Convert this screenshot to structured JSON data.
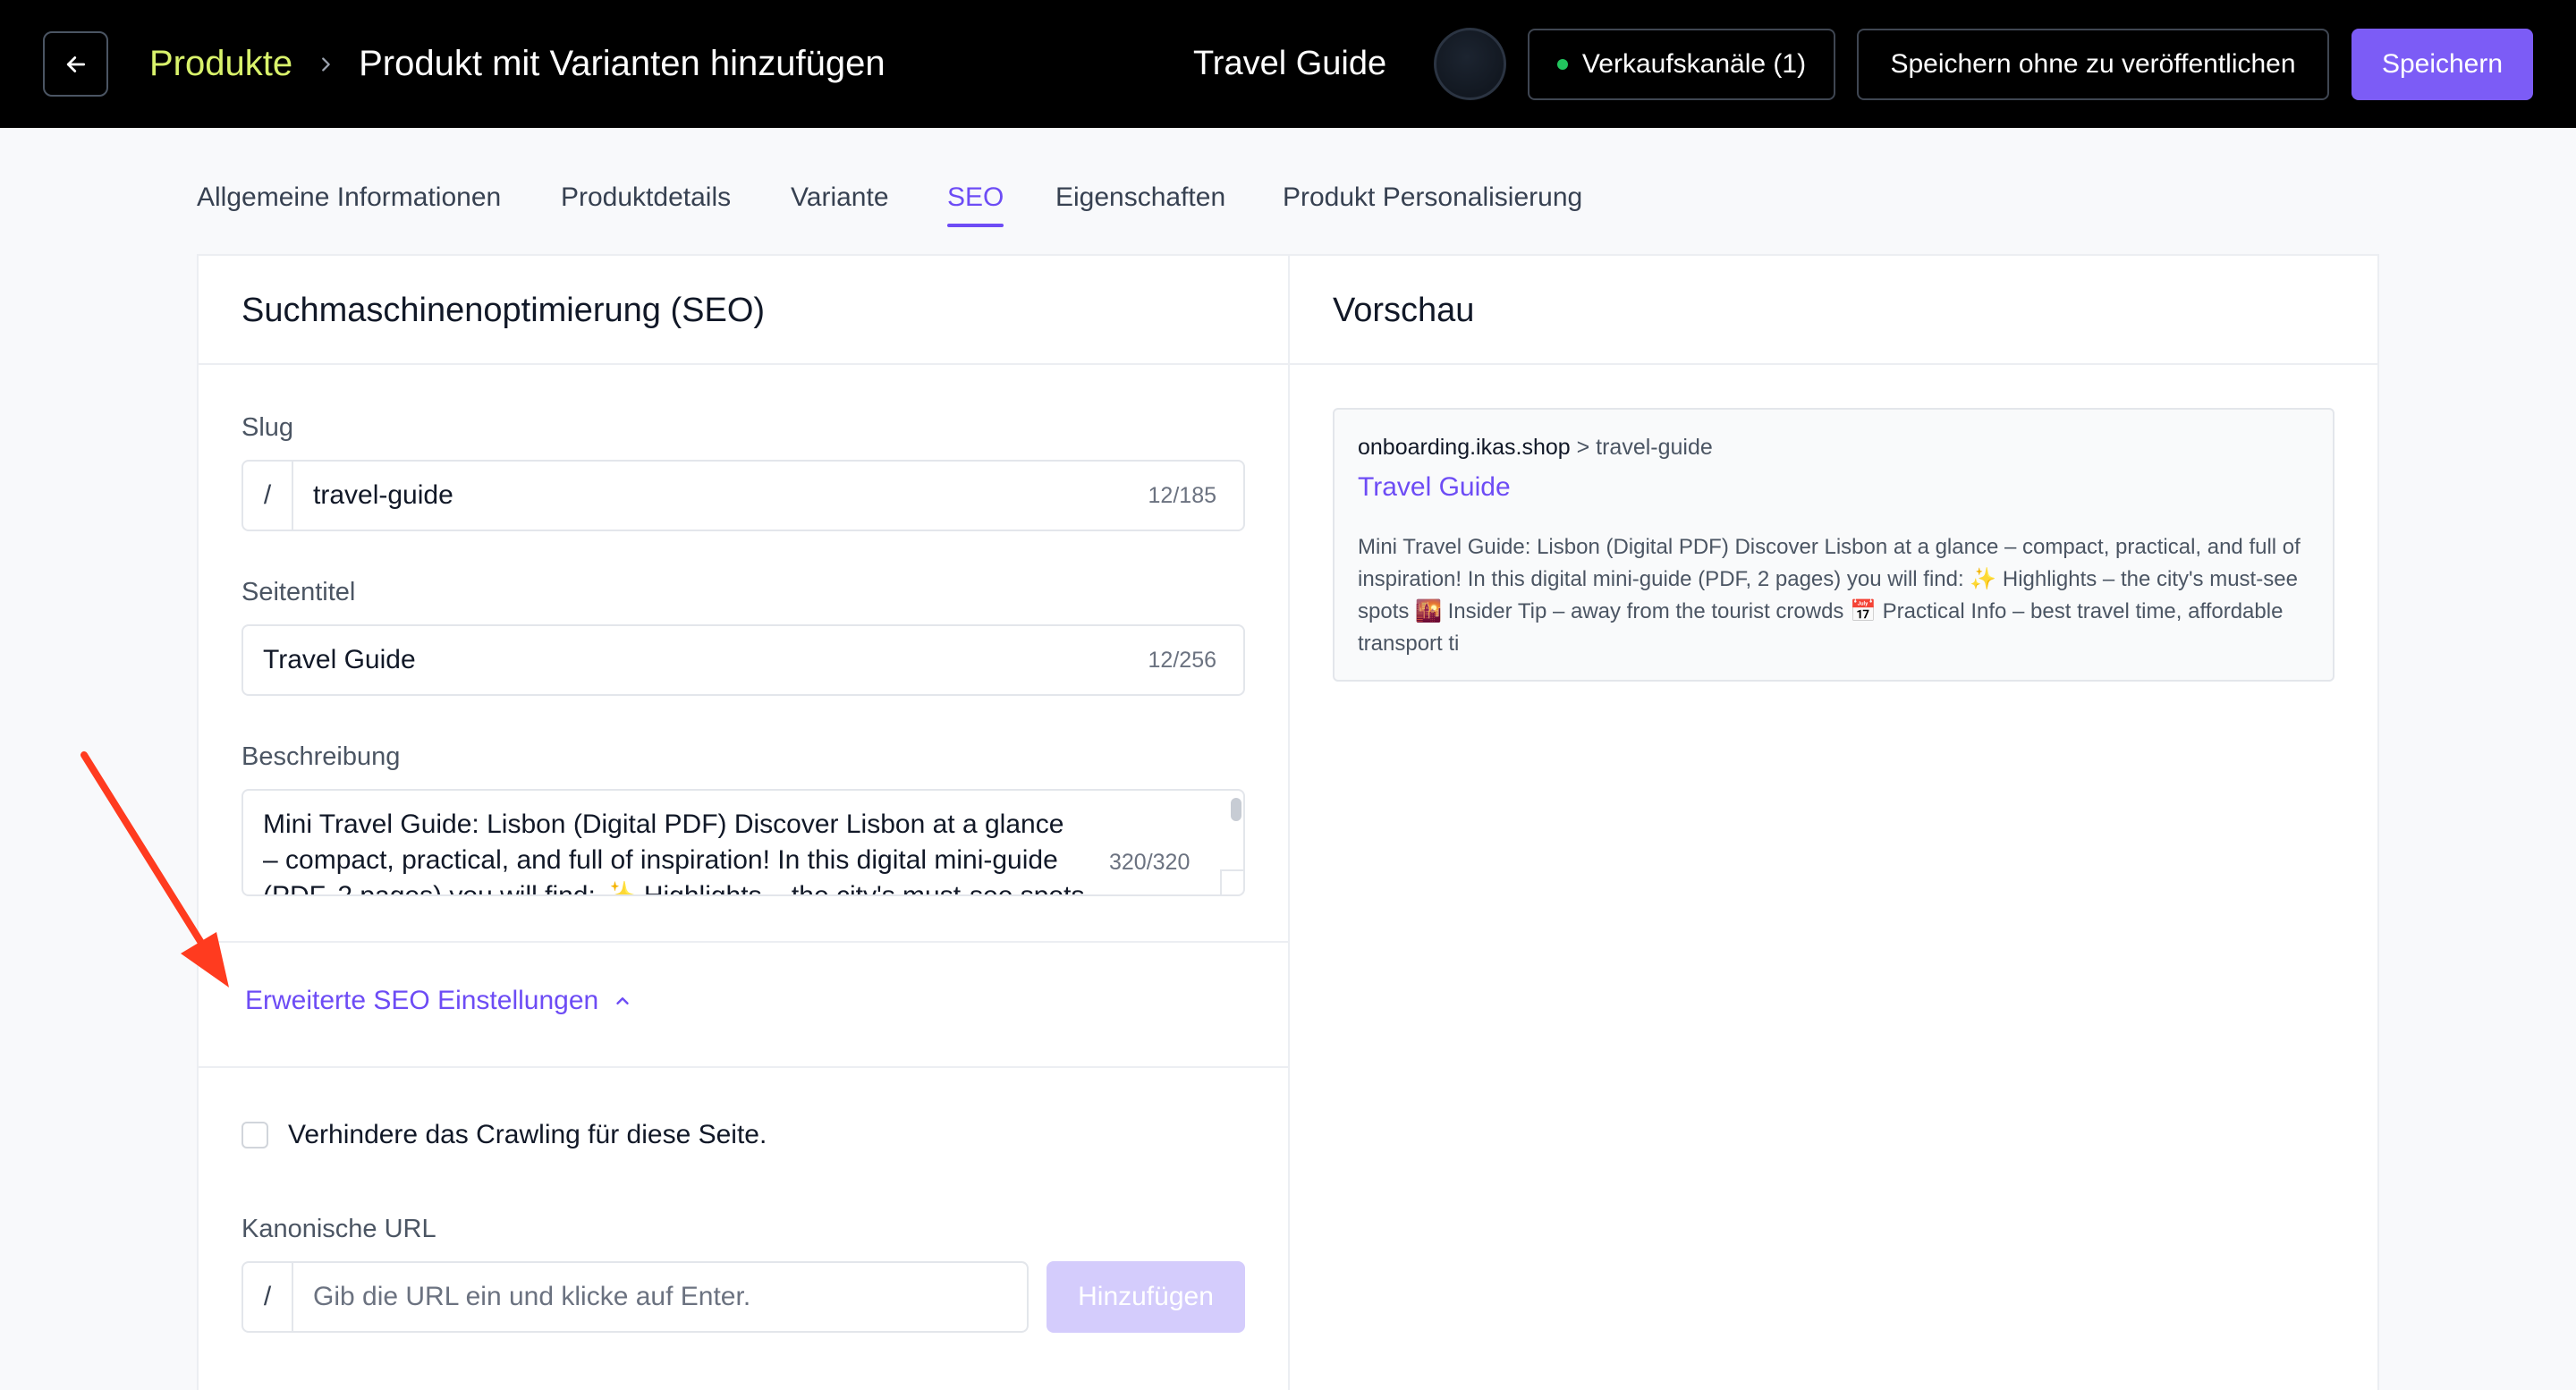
{
  "header": {
    "breadcrumb_root": "Produkte",
    "breadcrumb_current": "Produkt mit Varianten hinzufügen",
    "product_name": "Travel Guide",
    "channels_label": "Verkaufskanäle (1)",
    "save_draft_label": "Speichern ohne zu veröffentlichen",
    "save_label": "Speichern"
  },
  "tabs": [
    {
      "label": "Allgemeine Informationen",
      "active": false
    },
    {
      "label": "Produktdetails",
      "active": false
    },
    {
      "label": "Variante",
      "active": false
    },
    {
      "label": "SEO",
      "active": true
    },
    {
      "label": "Eigenschaften",
      "active": false
    },
    {
      "label": "Produkt Personalisierung",
      "active": false
    }
  ],
  "seo": {
    "title": "Suchmaschinenoptimierung (SEO)",
    "slug_label": "Slug",
    "slug_prefix": "/",
    "slug_value": "travel-guide",
    "slug_counter": "12/185",
    "page_title_label": "Seitentitel",
    "page_title_value": "Travel Guide",
    "page_title_counter": "12/256",
    "description_label": "Beschreibung",
    "description_value": "Mini Travel Guide: Lisbon (Digital PDF) Discover Lisbon at a glance – compact, practical, and full of inspiration! In this digital mini-guide (PDF, 2 pages) you will find: ✨ Highlights – the city's must-see spots",
    "description_counter": "320/320",
    "advanced_toggle": "Erweiterte SEO Einstellungen",
    "noindex_label": "Verhindere das Crawling für diese Seite.",
    "canonical_label": "Kanonische URL",
    "canonical_prefix": "/",
    "canonical_placeholder": "Gib die URL ein und klicke auf Enter.",
    "add_button": "Hinzufügen"
  },
  "preview": {
    "title": "Vorschau",
    "domain": "onboarding.ikas.shop",
    "path": " > travel-guide",
    "page_title": "Travel Guide",
    "description": "Mini Travel Guide: Lisbon (Digital PDF) Discover Lisbon at a glance – compact, practical, and full of inspiration! In this digital mini-guide (PDF, 2 pages) you will find: ✨ Highlights – the city's must-see spots 🌇 Insider Tip – away from the tourist crowds 📅 Practical Info – best travel time, affordable transport ti"
  },
  "colors": {
    "accent": "#6d4cf5",
    "primary_button": "#7c5cf6",
    "breadcrumb_link": "#d9f26b",
    "channel_status": "#22c55e",
    "annotation_arrow": "#ff3b1f"
  },
  "icons": [
    "arrow-left-icon",
    "chevron-right-icon",
    "chevron-up-icon",
    "status-dot-icon",
    "annotation-arrow-icon"
  ]
}
